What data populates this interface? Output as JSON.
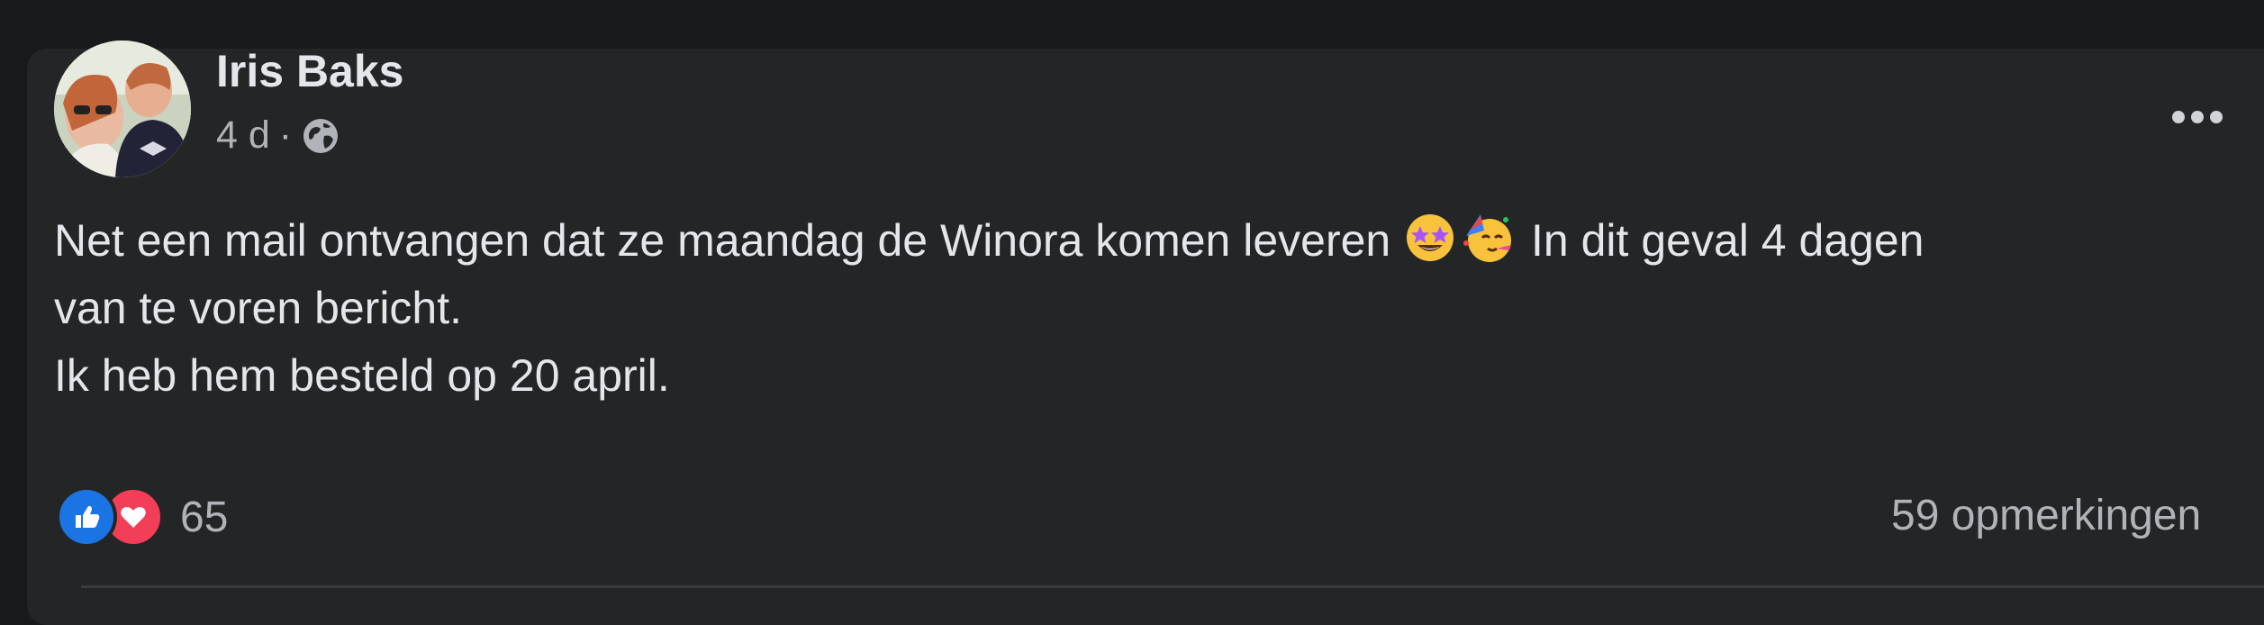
{
  "post": {
    "author": "Iris Baks",
    "time": "4 d",
    "separator": "·",
    "privacy_icon": "globe-icon",
    "text_lines": {
      "line1_before_emoji": "Net een mail ontvangen dat ze maandag de Winora komen leveren",
      "line1_after_emoji": " In dit geval 4 dagen",
      "line2": "van te voren bericht.",
      "line3": "Ik heb hem besteld op 20 april."
    },
    "emojis": [
      "star-struck-emoji",
      "partying-face-emoji"
    ]
  },
  "reactions": {
    "icons": [
      "like-icon",
      "love-icon"
    ],
    "count": "65"
  },
  "comments": {
    "label": "59 opmerkingen"
  },
  "colors": {
    "background": "#18191a",
    "card": "#242526",
    "text_primary": "#e4e6eb",
    "text_secondary": "#b0b3b8",
    "like_blue": "#1b74e4",
    "love_red": "#f33e58"
  }
}
